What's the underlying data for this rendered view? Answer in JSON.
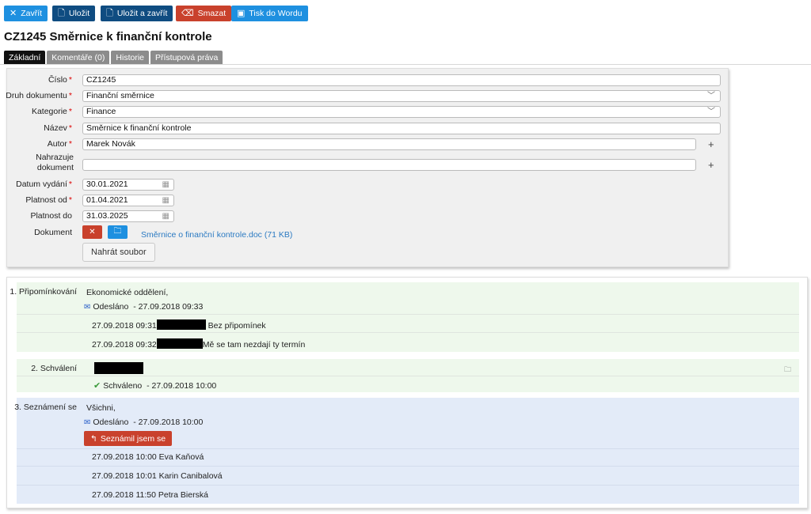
{
  "toolbar": {
    "close": "Zavřít",
    "save": "Uložit",
    "save_close": "Uložit a zavřít",
    "delete": "Smazat",
    "print": "Tisk do Wordu"
  },
  "page_title": "CZ1245 Směrnice k finanční kontrole",
  "tabs": [
    "Základní",
    "Komentáře (0)",
    "Historie",
    "Přístupová práva"
  ],
  "form": {
    "cislo_label": "Číslo",
    "cislo_value": "CZ1245",
    "druh_label": "Druh dokumentu",
    "druh_value": "Finanční směrnice",
    "kategorie_label": "Kategorie",
    "kategorie_value": "Finance",
    "nazev_label": "Název",
    "nazev_value": "Směrnice k finanční kontrole",
    "autor_label": "Autor",
    "autor_value": "Marek Novák",
    "nahrazuje_label_1": "Nahrazuje",
    "nahrazuje_label_2": "dokument",
    "nahrazuje_value": "",
    "datum_vydani_label": "Datum vydání",
    "datum_vydani_value": "30.01.2021",
    "platnost_od_label": "Platnost od",
    "platnost_od_value": "01.04.2021",
    "platnost_do_label": "Platnost do",
    "platnost_do_value": "31.03.2025",
    "dokument_label": "Dokument",
    "dokument_file": "Směrnice o finanční kontrole.doc (71 KB)",
    "upload_label": "Nahrát soubor",
    "required_mark": "*",
    "plus": "+"
  },
  "workflow": {
    "step1": {
      "label": "1. Připomínkování",
      "recipient": "Ekonomické oddělení,",
      "status": "Odesláno",
      "status_time": "- 27.09.2018 09:33",
      "entries": [
        {
          "time": "27.09.2018 09:31",
          "text": "Bez připomínek"
        },
        {
          "time": "27.09.2018 09:32",
          "text": "Mě se tam nezdají ty termín"
        }
      ]
    },
    "step2": {
      "label": "2. Schválení",
      "status": "Schváleno",
      "status_time": "- 27.09.2018 10:00"
    },
    "step3": {
      "label": "3. Seznámení se",
      "recipient": "Všichni,",
      "status": "Odesláno",
      "status_time": "- 27.09.2018 10:00",
      "ack_button": "Seznámil jsem se",
      "entries": [
        {
          "time": "27.09.2018 10:00",
          "text": "Eva Kaňová"
        },
        {
          "time": "27.09.2018 10:01",
          "text": "Karin Canibalová"
        },
        {
          "time": "27.09.2018 11:50",
          "text": "Petra Bierská"
        }
      ]
    }
  },
  "colors": {
    "blue": "#1e90e0",
    "navy": "#0f4c81",
    "red": "#c9412c",
    "link": "#2b7ac2",
    "green_bg": "#eef8ec",
    "blue_bg": "#e3ebf8"
  }
}
